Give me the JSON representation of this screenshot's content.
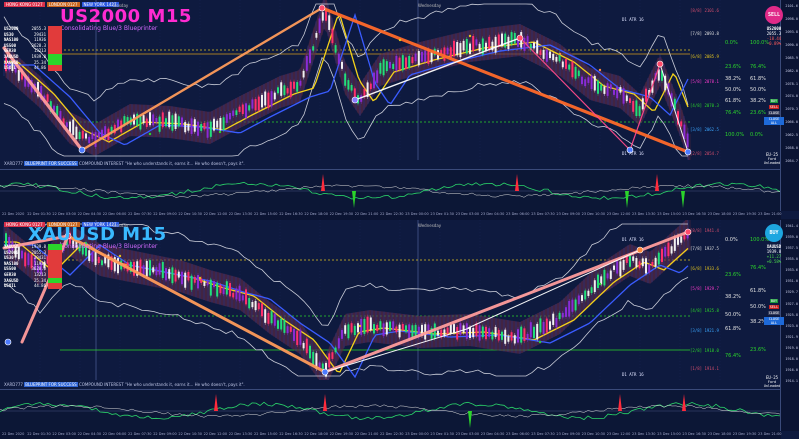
{
  "panes": [
    {
      "id": "top",
      "symbol_title": "US2000 M15",
      "title_color": "#ff2bd1",
      "subtitle": "Consolidating Blue/3 Blueprinter",
      "sessions": [
        {
          "label": "HONG KONG 0127",
          "color": "#d9314b"
        },
        {
          "label": "LONDON 0127",
          "color": "#c8651e"
        },
        {
          "label": "NEW YORK 1427",
          "color": "#2b58e0"
        }
      ],
      "day_labels": [
        "Tuesday",
        "Wednesday"
      ],
      "levels": [
        {
          "label": "[8/8] 2101.6",
          "color": "#d44d6d"
        },
        {
          "label": "[7/8] 2093.8",
          "color": "#e0e0e0"
        },
        {
          "label": "[6/8] 2085.9",
          "color": "#e3c41e"
        },
        {
          "label": "[5/8] 2078.1",
          "color": "#ff3bd0"
        },
        {
          "label": "[4/8] 2070.3",
          "color": "#2bd52b"
        },
        {
          "label": "[3/8] 2062.5",
          "color": "#3aa6ff"
        },
        {
          "label": "[2/8] 2054.7",
          "color": "#d44d6d"
        }
      ],
      "pcts": [
        {
          "label": "0.0%",
          "color": "#2bd52b"
        },
        {
          "label": "100.0%",
          "color": "#2bd52b"
        },
        {
          "label": "23.6%",
          "color": "#2bd52b"
        },
        {
          "label": "76.4%",
          "color": "#2bd52b"
        },
        {
          "label": "38.2%",
          "color": "#e0e0e0"
        },
        {
          "label": "61.8%",
          "color": "#e0e0e0"
        },
        {
          "label": "50.0%",
          "color": "#e0e0e0"
        },
        {
          "label": "50.0%",
          "color": "#e0e0e0"
        },
        {
          "label": "61.8%",
          "color": "#e0e0e0"
        },
        {
          "label": "38.2%",
          "color": "#e0e0e0"
        },
        {
          "label": "76.4%",
          "color": "#2bd52b"
        },
        {
          "label": "23.6%",
          "color": "#2bd52b"
        },
        {
          "label": "100.0%",
          "color": "#2bd52b"
        },
        {
          "label": "0.0%",
          "color": "#2bd52b"
        }
      ],
      "atr_top": "D1 ATR 16",
      "atr_bottom": "D1 ATR 16",
      "watermark_a": "XARD777 ",
      "watermark_hl": "BLUEPRINT FOR SUCCESS",
      "watermark_b": "  COMPOUND INTEREST  \"He who understands it, earns it... He who doesn't, pays it\".",
      "scale": [
        "2101.6",
        "2098.0",
        "2093.8",
        "2090.0",
        "2085.9",
        "2082.0",
        "2078.1",
        "2074.0",
        "2070.3",
        "2066.0",
        "2062.5",
        "2058.0",
        "2054.7"
      ],
      "panel": [
        {
          "sym": "US2000",
          "val": "2055.3",
          "c": "#e13b3b"
        },
        {
          "sym": "US30",
          "val": "29431",
          "c": "#e13b3b"
        },
        {
          "sym": "NAS100",
          "val": "11936",
          "c": "#e13b3b"
        },
        {
          "sym": "US500",
          "val": "3628.3",
          "c": "#e13b3b"
        },
        {
          "sym": "GER30",
          "val": "13213",
          "c": "#e13b3b"
        },
        {
          "sym": "XAUUSD",
          "val": "1939.8",
          "c": "#2bd52b"
        },
        {
          "sym": "XAGUSD",
          "val": "25.34",
          "c": "#2bd52b"
        },
        {
          "sym": "USOIL",
          "val": "44.86",
          "c": "#e13b3b"
        }
      ],
      "right_badge": {
        "label": "SELL",
        "color": "#e02a88"
      },
      "right_sym": "US2000",
      "right_info": [
        "2055.3",
        "-18.44",
        "-0.89%"
      ],
      "right_btns": [
        {
          "label": "BUY",
          "color": "#1a9a3a"
        },
        {
          "label": "SELL",
          "color": "#c72020"
        }
      ],
      "right_close": "CLOSE",
      "right_closeall": "CLOSE ALL",
      "right_tz": "EU-25",
      "right_clock": "Ford Unleaded",
      "axis": [
        "22 Dec 2020",
        "22 Dec 01:30",
        "22 Dec 03:00",
        "22 Dec 04:30",
        "22 Dec 06:00",
        "22 Dec 07:30",
        "22 Dec 09:00",
        "22 Dec 10:30",
        "22 Dec 12:00",
        "22 Dec 13:30",
        "22 Dec 15:00",
        "22 Dec 16:30",
        "22 Dec 18:00",
        "22 Dec 19:30",
        "22 Dec 21:00",
        "22 Dec 22:30",
        "23 Dec 00:00",
        "23 Dec 01:30",
        "23 Dec 03:00",
        "23 Dec 04:30",
        "23 Dec 06:00",
        "23 Dec 07:30",
        "23 Dec 09:00",
        "23 Dec 10:30",
        "23 Dec 12:00",
        "23 Dec 13:30",
        "23 Dec 15:00",
        "23 Dec 16:30",
        "23 Dec 18:00",
        "23 Dec 19:30",
        "23 Dec 21:00"
      ]
    },
    {
      "id": "bottom",
      "symbol_title": "XAUUSD M15",
      "title_color": "#39b9ff",
      "subtitle": "Consolidating Blue/3 Blueprinter",
      "sessions": [
        {
          "label": "HONG KONG 0127",
          "color": "#d9314b"
        },
        {
          "label": "LONDON 0127",
          "color": "#c8651e"
        },
        {
          "label": "NEW YORK 1427",
          "color": "#2b58e0"
        }
      ],
      "day_labels": [
        "Tuesday",
        "Wednesday"
      ],
      "levels": [
        {
          "label": "[8/8] 1941.4",
          "color": "#d44d6d"
        },
        {
          "label": "[7/8] 1937.5",
          "color": "#e0e0e0"
        },
        {
          "label": "[6/8] 1933.6",
          "color": "#e3c41e"
        },
        {
          "label": "[5/8] 1929.7",
          "color": "#ff3bd0"
        },
        {
          "label": "[4/8] 1925.8",
          "color": "#2bd52b"
        },
        {
          "label": "[3/8] 1921.9",
          "color": "#3aa6ff"
        },
        {
          "label": "[2/8] 1918.0",
          "color": "#2bd52b"
        },
        {
          "label": "[1/8] 1914.1",
          "color": "#d44d6d"
        }
      ],
      "pcts": [
        {
          "label": "0.0%",
          "color": "#e0e0e0"
        },
        {
          "label": "100.0%",
          "color": "#2bd52b"
        },
        {
          "label": "76.4%",
          "color": "#2bd52b"
        },
        {
          "label": "23.6%",
          "color": "#2bd52b"
        },
        {
          "label": "61.8%",
          "color": "#e0e0e0"
        },
        {
          "label": "38.2%",
          "color": "#e0e0e0"
        },
        {
          "label": "50.0%",
          "color": "#e0e0e0"
        },
        {
          "label": "50.0%",
          "color": "#e0e0e0"
        },
        {
          "label": "38.2%",
          "color": "#e0e0e0"
        },
        {
          "label": "61.8%",
          "color": "#e0e0e0"
        },
        {
          "label": "23.6%",
          "color": "#2bd52b"
        },
        {
          "label": "76.4%",
          "color": "#2bd52b"
        }
      ],
      "atr_top": "D1 ATR 16",
      "atr_bottom": "D1 ATR 16",
      "watermark_a": "XARD777 ",
      "watermark_hl": "BLUEPRINT FOR SUCCESS",
      "watermark_b": "  COMPOUND INTEREST  \"He who understands it, earns it... He who doesn't, pays it\".",
      "scale": [
        "1941.4",
        "1939.0",
        "1937.5",
        "1935.0",
        "1933.6",
        "1931.0",
        "1929.7",
        "1927.0",
        "1925.8",
        "1923.0",
        "1921.9",
        "1919.0",
        "1918.0",
        "1916.0",
        "1914.1"
      ],
      "panel": [
        {
          "sym": "XAUUSD",
          "val": "1939.8",
          "c": "#2bd52b"
        },
        {
          "sym": "US2000",
          "val": "2055.3",
          "c": "#e13b3b"
        },
        {
          "sym": "US30",
          "val": "29431",
          "c": "#e13b3b"
        },
        {
          "sym": "NAS100",
          "val": "11936",
          "c": "#e13b3b"
        },
        {
          "sym": "US500",
          "val": "3628.3",
          "c": "#e13b3b"
        },
        {
          "sym": "GER30",
          "val": "13213",
          "c": "#e13b3b"
        },
        {
          "sym": "XAGUSD",
          "val": "25.34",
          "c": "#2bd52b"
        },
        {
          "sym": "USOIL",
          "val": "44.86",
          "c": "#e13b3b"
        }
      ],
      "right_badge": {
        "label": "BUY",
        "color": "#1ea6e0"
      },
      "right_sym": "XAUUSD",
      "right_info": [
        "1939.8",
        "+11.27",
        "+0.58%"
      ],
      "right_btns": [
        {
          "label": "BUY",
          "color": "#1a9a3a"
        },
        {
          "label": "SELL",
          "color": "#c72020"
        }
      ],
      "right_close": "CLOSE",
      "right_closeall": "CLOSE ALL",
      "right_tz": "EU-25",
      "right_clock": "Ford Unleaded",
      "axis": [
        "22 Dec 2020",
        "22 Dec 01:30",
        "22 Dec 03:00",
        "22 Dec 04:30",
        "22 Dec 06:00",
        "22 Dec 07:30",
        "22 Dec 09:00",
        "22 Dec 10:30",
        "22 Dec 12:00",
        "22 Dec 13:30",
        "22 Dec 15:00",
        "22 Dec 16:30",
        "22 Dec 18:00",
        "22 Dec 19:30",
        "22 Dec 21:00",
        "22 Dec 22:30",
        "23 Dec 00:00",
        "23 Dec 01:30",
        "23 Dec 03:00",
        "23 Dec 04:30",
        "23 Dec 06:00",
        "23 Dec 07:30",
        "23 Dec 09:00",
        "23 Dec 10:30",
        "23 Dec 12:00",
        "23 Dec 13:30",
        "23 Dec 15:00",
        "23 Dec 16:30",
        "23 Dec 18:00",
        "23 Dec 19:30",
        "23 Dec 21:00"
      ]
    }
  ]
}
